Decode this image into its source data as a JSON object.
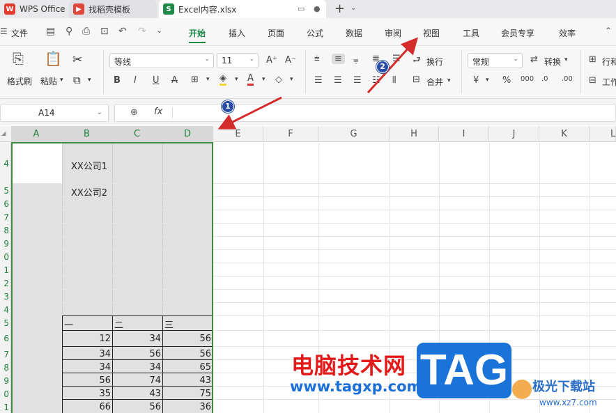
{
  "tabs": [
    {
      "label": "WPS Office",
      "icon": "wps-logo-icon"
    },
    {
      "label": "找稻壳模板",
      "icon": "docer-icon"
    },
    {
      "label": "Excel内容.xlsx",
      "icon": "spreadsheet-s-icon"
    }
  ],
  "menu": {
    "file_label": "文件",
    "items": [
      "开始",
      "插入",
      "页面",
      "公式",
      "数据",
      "审阅",
      "视图",
      "工具",
      "会员专享",
      "效率"
    ],
    "active": "开始"
  },
  "ribbon": {
    "format_painter": "格式刷",
    "paste": "粘贴",
    "font_name": "等线",
    "font_size": "11",
    "wrap": "换行",
    "merge": "合并",
    "number_format": "常规",
    "convert": "转换",
    "rows_cols": "行和",
    "worksheet": "工作"
  },
  "formula_bar": {
    "name_box": "A14",
    "fx": "fx",
    "formula": ""
  },
  "columns": [
    "A",
    "B",
    "C",
    "D",
    "E",
    "F",
    "G",
    "H",
    "I",
    "J",
    "K",
    "L"
  ],
  "rows": [
    "4",
    "5",
    "6",
    "7",
    "8",
    "9",
    "0",
    "1",
    "2",
    "3",
    "4",
    "5",
    "6",
    "7",
    "8",
    "9",
    "0",
    "1"
  ],
  "cells": {
    "b4": "XX公司1",
    "b5": "XX公司2",
    "h1": "一",
    "h2": "二",
    "h3": "三",
    "table": [
      [
        "12",
        "34",
        "56"
      ],
      [
        "34",
        "56",
        "56"
      ],
      [
        "34",
        "34",
        "65"
      ],
      [
        "56",
        "74",
        "43"
      ],
      [
        "35",
        "43",
        "75"
      ],
      [
        "66",
        "56",
        "36"
      ]
    ]
  },
  "annotations": {
    "badge1": "1",
    "badge2": "2",
    "color": "#d42b2b"
  },
  "watermark": {
    "cn": "电脑技术网",
    "url": "www.tagxp.com",
    "tag": "TAG",
    "site_cn": "极光下载站",
    "site_url": "www.xz7.com"
  },
  "colors": {
    "accent": "#1d8a4a",
    "selection": "#3d8b3d"
  }
}
